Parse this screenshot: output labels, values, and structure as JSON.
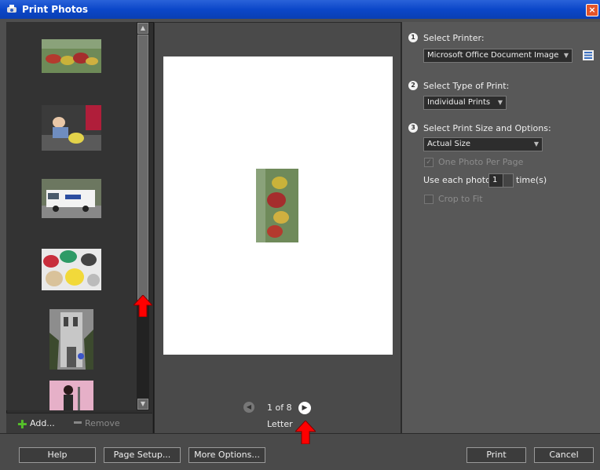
{
  "window": {
    "title": "Print Photos",
    "close_icon": "close-icon"
  },
  "left_panel": {
    "add_label": "Add...",
    "remove_label": "Remove"
  },
  "preview": {
    "pager_text": "1 of 8",
    "paper_size": "Letter"
  },
  "options": {
    "step1": {
      "number": "1",
      "label": "Select Printer:",
      "value": "Microsoft Office Document Image"
    },
    "step2": {
      "number": "2",
      "label": "Select Type of Print:",
      "value": "Individual Prints"
    },
    "step3": {
      "number": "3",
      "label": "Select Print Size and Options:",
      "value": "Actual Size"
    },
    "one_photo_per_page": "One Photo Per Page",
    "use_each_photo_label": "Use each photo",
    "use_each_photo_value": "1",
    "times_label": "time(s)",
    "crop_to_fit": "Crop to Fit"
  },
  "buttons": {
    "help": "Help",
    "page_setup": "Page Setup...",
    "more_options": "More Options...",
    "print": "Print",
    "cancel": "Cancel"
  }
}
